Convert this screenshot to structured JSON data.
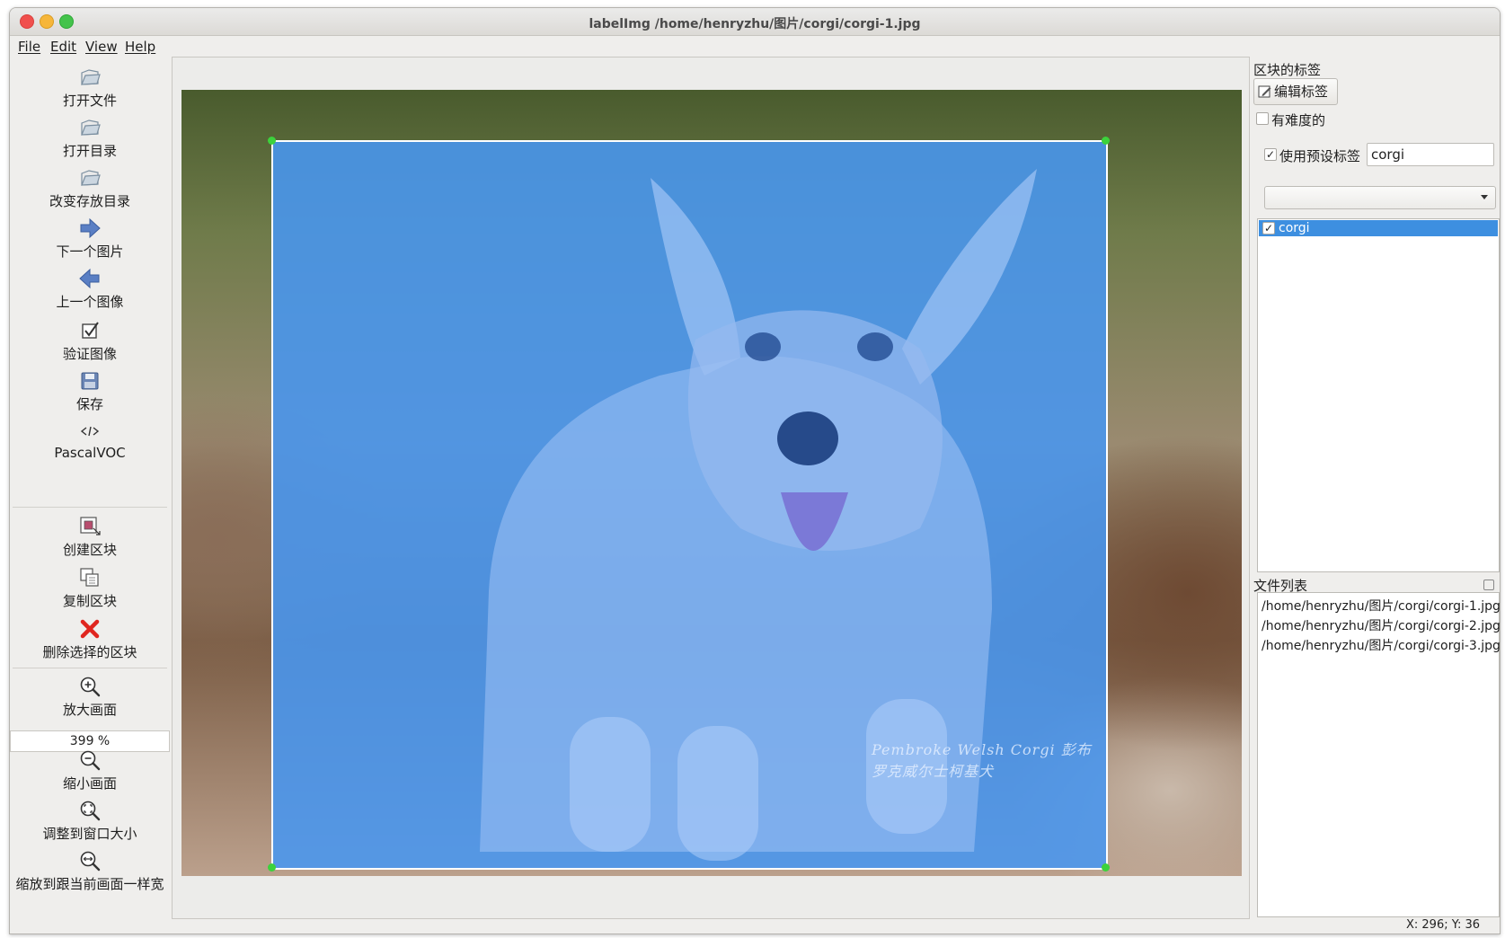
{
  "window": {
    "title": "labelImg /home/henryzhu/图片/corgi/corgi-1.jpg"
  },
  "menu": [
    {
      "label": "File"
    },
    {
      "label": "Edit"
    },
    {
      "label": "View"
    },
    {
      "label": "Help"
    }
  ],
  "toolbar": {
    "open_file": "打开文件",
    "open_dir": "打开目录",
    "change_save_dir": "改变存放目录",
    "next_image": "下一个图片",
    "prev_image": "上一个图像",
    "verify_image": "验证图像",
    "save": "保存",
    "format": "PascalVOC",
    "create_box": "创建区块",
    "duplicate_box": "复制区块",
    "delete_box": "删除选择的区块",
    "zoom_in": "放大画面",
    "zoom_value": "399 %",
    "zoom_out": "缩小画面",
    "fit_window": "调整到窗口大小",
    "fit_width": "缩放到跟当前画面一样宽"
  },
  "canvas": {
    "watermark": "Pembroke Welsh Corgi 彭布罗克威尔士柯基犬"
  },
  "label_dock": {
    "title": "区块的标签",
    "edit_button": "编辑标签",
    "difficult_label": "有难度的",
    "difficult_checked": false,
    "use_default_label": "使用预设标签",
    "use_default_checked": true,
    "default_label_value": "corgi",
    "combo_value": "",
    "labels": [
      {
        "text": "corgi",
        "checked": true
      }
    ]
  },
  "file_dock": {
    "title": "文件列表",
    "files": [
      "/home/henryzhu/图片/corgi/corgi-1.jpg",
      "/home/henryzhu/图片/corgi/corgi-2.jpg",
      "/home/henryzhu/图片/corgi/corgi-3.jpg"
    ]
  },
  "status": {
    "coords": "X: 296; Y: 36"
  },
  "colors": {
    "accent": "#3d8fe0",
    "bbox_fill": "#4896f0",
    "handle": "#3cd23c",
    "close": "#f0504d",
    "minimize": "#f6b63a",
    "maximize": "#44c34b"
  }
}
